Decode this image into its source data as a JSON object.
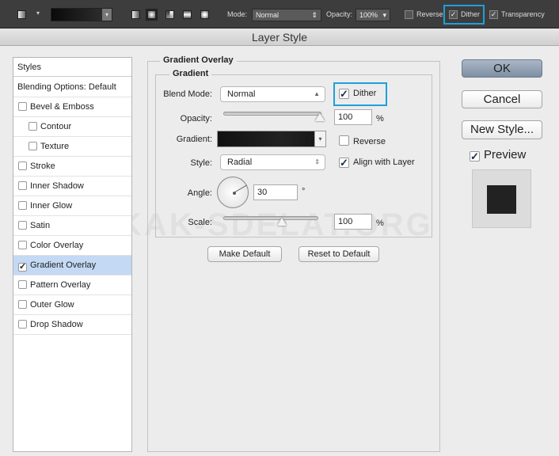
{
  "toolbar": {
    "mode_label": "Mode:",
    "mode_value": "Normal",
    "opacity_label": "Opacity:",
    "opacity_value": "100%",
    "reverse_label": "Reverse",
    "reverse_checked": false,
    "dither_label": "Dither",
    "dither_checked": true,
    "transparency_label": "Transparency",
    "transparency_checked": true,
    "highlight_color": "#1ea0d8"
  },
  "dialog": {
    "title": "Layer Style"
  },
  "sidebar": {
    "header": "Styles",
    "items": [
      {
        "label": "Blending Options: Default",
        "checkbox": false
      },
      {
        "label": "Bevel & Emboss",
        "checkbox": true,
        "checked": false
      },
      {
        "label": "Contour",
        "checkbox": true,
        "checked": false,
        "sub": true
      },
      {
        "label": "Texture",
        "checkbox": true,
        "checked": false,
        "sub": true
      },
      {
        "label": "Stroke",
        "checkbox": true,
        "checked": false
      },
      {
        "label": "Inner Shadow",
        "checkbox": true,
        "checked": false
      },
      {
        "label": "Inner Glow",
        "checkbox": true,
        "checked": false
      },
      {
        "label": "Satin",
        "checkbox": true,
        "checked": false
      },
      {
        "label": "Color Overlay",
        "checkbox": true,
        "checked": false
      },
      {
        "label": "Gradient Overlay",
        "checkbox": true,
        "checked": true,
        "selected": true
      },
      {
        "label": "Pattern Overlay",
        "checkbox": true,
        "checked": false
      },
      {
        "label": "Outer Glow",
        "checkbox": true,
        "checked": false
      },
      {
        "label": "Drop Shadow",
        "checkbox": true,
        "checked": false
      }
    ]
  },
  "panel": {
    "title": "Gradient Overlay",
    "group": "Gradient",
    "blend_mode_label": "Blend Mode:",
    "blend_mode": "Normal",
    "dither_label": "Dither",
    "dither_checked": true,
    "opacity_label": "Opacity:",
    "opacity": "100",
    "opacity_unit": "%",
    "opacity_percent": 100,
    "gradient_label": "Gradient:",
    "reverse_label": "Reverse",
    "reverse_checked": false,
    "style_label": "Style:",
    "style": "Radial",
    "align_label": "Align with Layer",
    "align_checked": true,
    "angle_label": "Angle:",
    "angle": "30",
    "angle_unit": "°",
    "scale_label": "Scale:",
    "scale": "100",
    "scale_unit": "%",
    "scale_slider_fraction": 0.5,
    "make_default": "Make Default",
    "reset_default": "Reset to Default"
  },
  "buttons": {
    "ok": "OK",
    "cancel": "Cancel",
    "new_style": "New Style...",
    "preview_label": "Preview",
    "preview_checked": true
  },
  "watermark": "KAK-SDELAT.ORG"
}
